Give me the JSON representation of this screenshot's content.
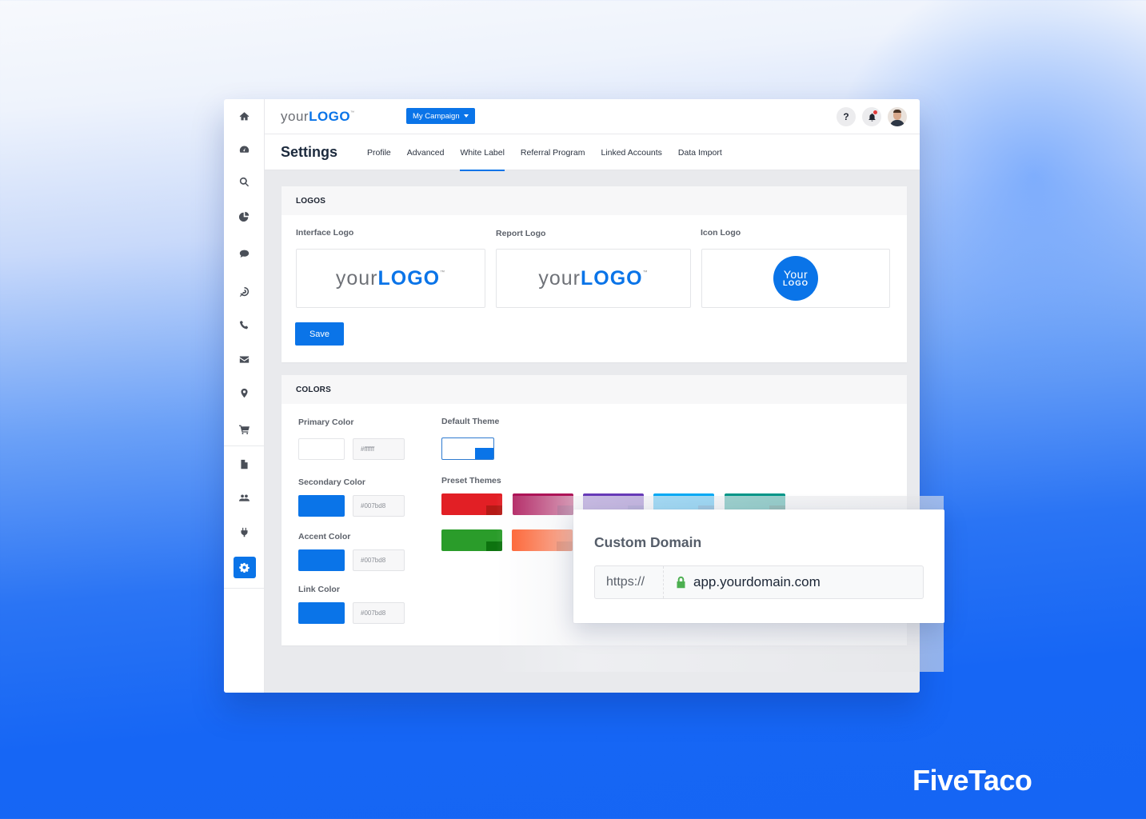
{
  "app": {
    "brand": {
      "your": "your",
      "logo": "LOGO",
      "tm": "™"
    },
    "campaign_selector": "My Campaign"
  },
  "sidebar": {
    "items": [
      {
        "icon": "home-icon",
        "label": "Home"
      },
      {
        "icon": "dashboard-icon",
        "label": "Dashboard"
      },
      {
        "icon": "search-icon",
        "label": "Search"
      },
      {
        "icon": "pie-chart-icon",
        "label": "Reports"
      },
      {
        "icon": "chat-icon",
        "label": "Chat"
      },
      {
        "icon": "target-icon",
        "label": "Targeting"
      },
      {
        "icon": "phone-icon",
        "label": "Calls"
      },
      {
        "icon": "envelope-icon",
        "label": "Email"
      },
      {
        "icon": "location-pin-icon",
        "label": "Local"
      },
      {
        "icon": "cart-icon",
        "label": "Ecommerce"
      },
      {
        "icon": "document-icon",
        "label": "Documents"
      },
      {
        "icon": "users-icon",
        "label": "Users"
      },
      {
        "icon": "plug-icon",
        "label": "Integrations"
      },
      {
        "icon": "gear-icon",
        "label": "Settings",
        "active": true
      }
    ]
  },
  "header": {
    "help_label": "?",
    "has_notification": true
  },
  "settings": {
    "title": "Settings",
    "tabs": [
      {
        "label": "Profile"
      },
      {
        "label": "Advanced"
      },
      {
        "label": "White Label",
        "active": true
      },
      {
        "label": "Referral Program"
      },
      {
        "label": "Linked Accounts"
      },
      {
        "label": "Data Import"
      }
    ]
  },
  "logos": {
    "heading": "LOGOS",
    "interface_label": "Interface Logo",
    "report_label": "Report Logo",
    "icon_label": "Icon Logo",
    "logo_text": {
      "your": "your",
      "logo": "LOGO",
      "tm": "™"
    },
    "icon_logo_text": {
      "line1": "Your",
      "line2": "LOGO"
    },
    "save_label": "Save"
  },
  "colors": {
    "heading": "COLORS",
    "fields": [
      {
        "label": "Primary Color",
        "value": "#ffffff",
        "swatch": "#ffffff"
      },
      {
        "label": "Secondary Color",
        "value": "#007bd8",
        "swatch": "#0a74e8"
      },
      {
        "label": "Accent Color",
        "value": "#007bd8",
        "swatch": "#0a74e8"
      },
      {
        "label": "Link Color",
        "value": "#007bd8",
        "swatch": "#0a74e8"
      }
    ],
    "default_theme_label": "Default Theme",
    "preset_themes_label": "Preset Themes",
    "preset_themes": [
      {
        "color": "#e21f25",
        "accent": "#b51a16"
      },
      {
        "color": "#ad1457",
        "accent": "#880e4f"
      },
      {
        "color": "#673ab7",
        "accent": "#4527a0"
      },
      {
        "color": "#03a9f4",
        "accent": "#0277bd"
      },
      {
        "color": "#009688",
        "accent": "#00695c"
      },
      {
        "color": "#2a9c2a",
        "accent": "#0d730f"
      },
      {
        "color": "#ff5722",
        "accent": "#d84315"
      }
    ]
  },
  "custom_domain": {
    "title": "Custom Domain",
    "prefix": "https://",
    "value": "app.yourdomain.com",
    "lock_color": "#4caf50"
  },
  "watermark": "FiveTaco"
}
